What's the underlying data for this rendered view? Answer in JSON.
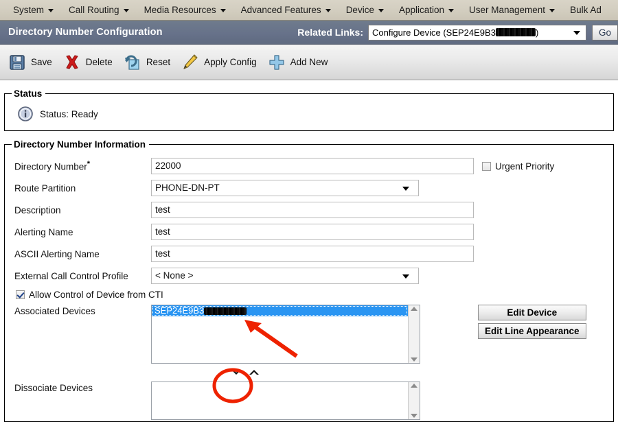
{
  "menubar": {
    "items": [
      {
        "label": "System",
        "caret": true
      },
      {
        "label": "Call Routing",
        "caret": true
      },
      {
        "label": "Media Resources",
        "caret": true
      },
      {
        "label": "Advanced Features",
        "caret": true
      },
      {
        "label": "Device",
        "caret": true
      },
      {
        "label": "Application",
        "caret": true
      },
      {
        "label": "User Management",
        "caret": true
      },
      {
        "label": "Bulk Ad",
        "caret": false
      }
    ]
  },
  "titlebar": {
    "title": "Directory Number Configuration",
    "related_links_label": "Related Links:",
    "related_links_value_prefix": "Configure Device (SEP24E9B3",
    "related_links_value_suffix": ")",
    "go_label": "Go"
  },
  "toolbar": {
    "save_label": "Save",
    "delete_label": "Delete",
    "reset_label": "Reset",
    "apply_config_label": "Apply Config",
    "add_new_label": "Add New"
  },
  "status": {
    "legend": "Status",
    "text": "Status: Ready",
    "icon": "info-icon"
  },
  "dn_info": {
    "legend": "Directory Number Information",
    "fields": [
      {
        "label": "Directory Number",
        "required": true,
        "type": "text",
        "value": "22000"
      },
      {
        "label": "Route Partition",
        "required": false,
        "type": "select",
        "value": "PHONE-DN-PT"
      },
      {
        "label": "Description",
        "required": false,
        "type": "text",
        "value": "test"
      },
      {
        "label": "Alerting Name",
        "required": false,
        "type": "text",
        "value": "test"
      },
      {
        "label": "ASCII Alerting Name",
        "required": false,
        "type": "text",
        "value": "test"
      },
      {
        "label": "External Call Control Profile",
        "required": false,
        "type": "select",
        "value": "< None >"
      }
    ],
    "urgent_priority": {
      "label": "Urgent Priority",
      "checked": false
    },
    "allow_cti": {
      "label": "Allow Control of Device from CTI",
      "checked": true
    },
    "associated_devices": {
      "label": "Associated Devices",
      "options": [
        {
          "text_prefix": "SEP24E9B3",
          "redacted": true,
          "selected": true
        }
      ]
    },
    "dissociate_devices": {
      "label": "Dissociate Devices",
      "options": []
    },
    "edit_device_label": "Edit Device",
    "edit_line_appearance_label": "Edit Line Appearance"
  },
  "annotations": {
    "arrow_color": "#ee2200",
    "circle_color": "#ee2200",
    "circle_note_icons": [
      "chevron-down-icon",
      "chevron-up-icon"
    ]
  },
  "colors": {
    "menubar_bg": "#d3cec0",
    "titlebar_bg": "#67728a",
    "selection_blue": "#2a95f2",
    "annotation_red": "#ee2200"
  }
}
